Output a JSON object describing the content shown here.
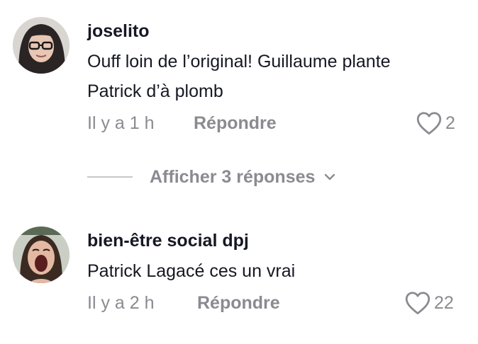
{
  "comments": [
    {
      "username": "joselito",
      "text_line1": "Ouff loin de l’original! Guillaume plante",
      "text_line2": "Patrick d’à plomb",
      "time": "Il y a 1 h",
      "reply_label": "Répondre",
      "likes": "2",
      "avatar_icon": "profile-photo",
      "heart_icon": "heart-outline-icon"
    },
    {
      "username": "bien-être social dpj",
      "text_line1": "Patrick Lagacé ces un vrai",
      "time": "Il y a 2 h",
      "reply_label": "Répondre",
      "likes": "22",
      "avatar_icon": "profile-photo",
      "heart_icon": "heart-outline-icon"
    }
  ],
  "view_replies": {
    "label": "Afficher 3 réponses",
    "icon": "chevron-down-icon"
  },
  "colors": {
    "primary_text": "#161823",
    "secondary_text": "#8a8b91",
    "divider": "#c8c8cc",
    "background": "#ffffff"
  }
}
